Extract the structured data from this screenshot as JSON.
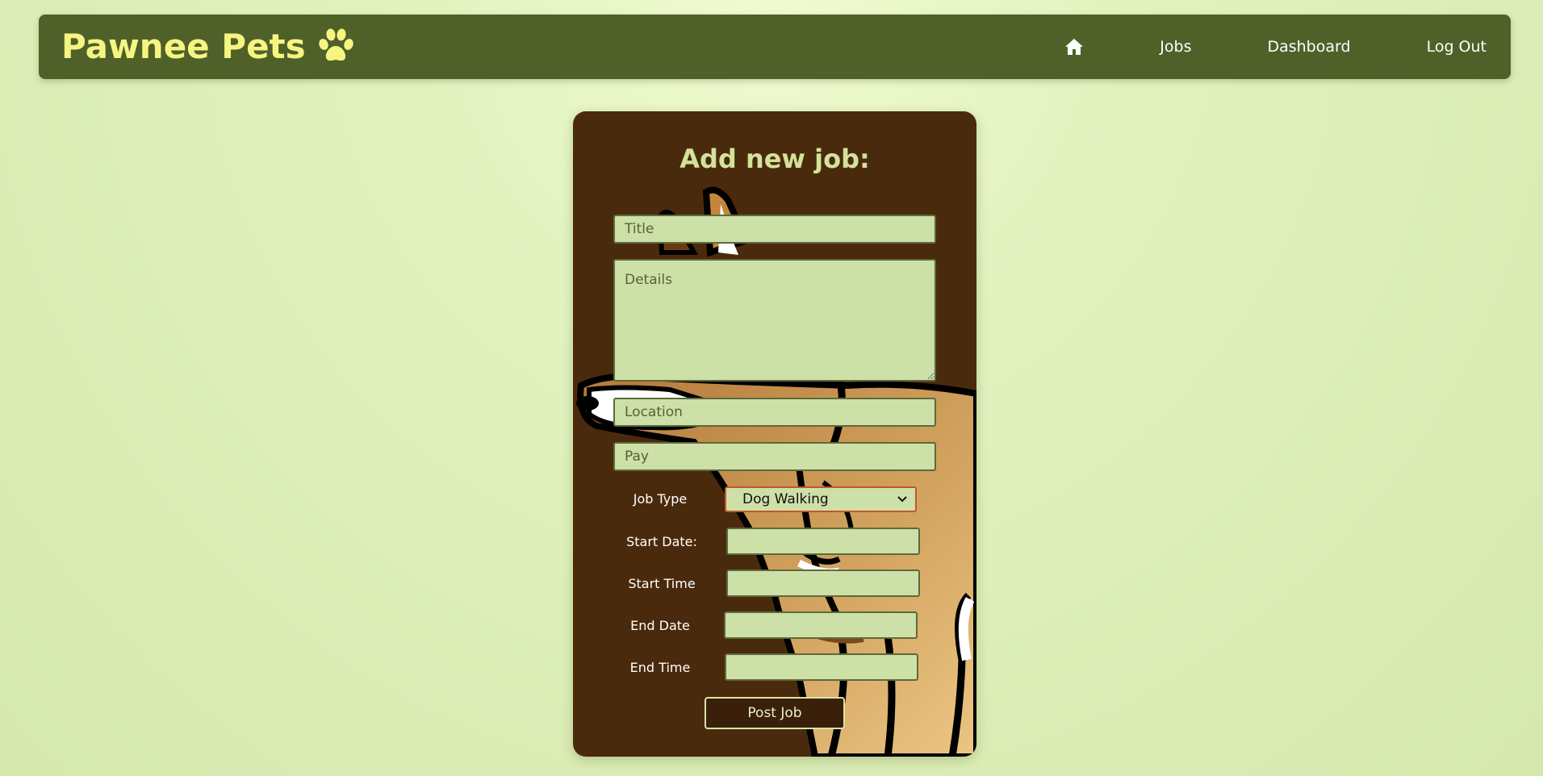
{
  "nav": {
    "brand": "Pawnee Pets",
    "links": [
      "Jobs",
      "Dashboard",
      "Log Out"
    ]
  },
  "form": {
    "heading": "Add new job:",
    "title_placeholder": "Title",
    "details_placeholder": "Details",
    "location_placeholder": "Location",
    "pay_placeholder": "Pay",
    "job_type_label": "Job Type",
    "job_type_value": "Dog Walking",
    "start_date_label": "Start Date:",
    "start_time_label": "Start Time",
    "end_date_label": "End Date",
    "end_time_label": "End Time",
    "submit_label": "Post Job"
  },
  "colors": {
    "navbar": "#4f6129",
    "brand": "#f6f582",
    "card": "#4a2a0c",
    "field": "#cde0a8",
    "heading": "#d2e29a"
  },
  "icons": {
    "brand_icon": "paw-icon",
    "home": "home-icon",
    "select_arrow": "chevron-down-icon"
  }
}
